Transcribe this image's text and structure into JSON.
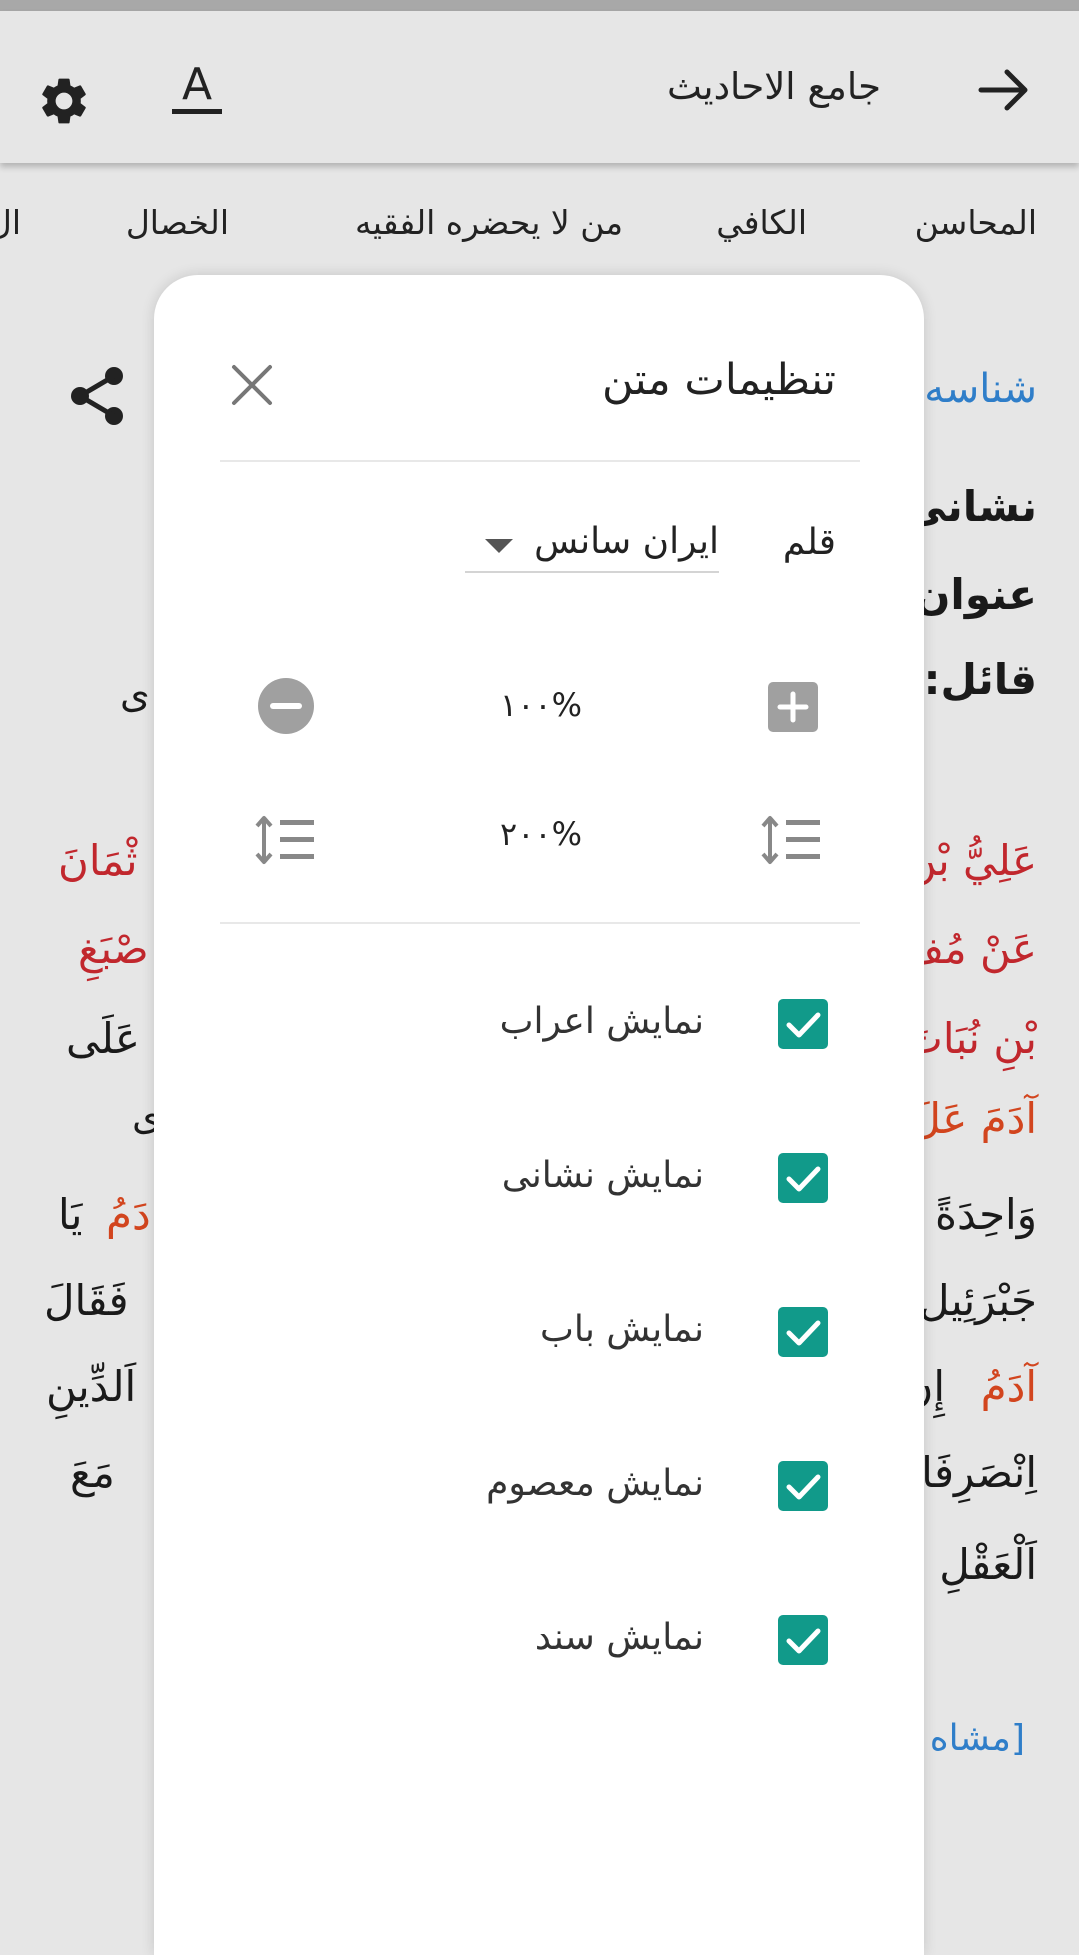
{
  "app_bar": {
    "title": "جامع الاحادیث",
    "font_icon_glyph": "A"
  },
  "book_tabs": [
    "المحاسن",
    "الكافي",
    "من لا يحضره الفقيه",
    "الخصال",
    "ال"
  ],
  "background": {
    "id_label": "شناسه",
    "line_neshani": "نشانی",
    "line_onvan": "عنوان",
    "line_qael": "قائل: ا",
    "line_qael_left": "ی",
    "hadith_lines": [
      {
        "right": "عَلِيُّ بْن",
        "left": "ثْمَانَ"
      },
      {
        "right": "عَنْ مُفَ",
        "left": "صْبَغِ"
      },
      {
        "right": "بْنِ نُبَاتَ",
        "left": "عَلَى"
      },
      {
        "right": "آدَمَ عَلَ",
        "left": "ى"
      },
      {
        "right": "وَاحِدَةً",
        "left_orange": "دَمُ",
        "left": "يَا"
      },
      {
        "right": "جَبْرَئِيل",
        "left": "فَقَالَ"
      },
      {
        "right_orange": "آدَمُ",
        "right": "إِنِّ",
        "left": "اَلدِّينِ"
      },
      {
        "right": "اِنْصَرِفَا",
        "left": "مَعَ"
      },
      {
        "right": "اَلْعَقْلِ",
        "left": ""
      }
    ],
    "see_more": "[مشاه"
  },
  "panel": {
    "title": "تنظیمات متن",
    "font_label": "قلم",
    "font_value": "ایران سانس",
    "font_size_value": "۱۰۰%",
    "line_height_value": "۲۰۰%",
    "checkboxes": [
      {
        "label": "نمایش اعراب",
        "checked": true
      },
      {
        "label": "نمایش نشانی",
        "checked": true
      },
      {
        "label": "نمایش باب",
        "checked": true
      },
      {
        "label": "نمایش معصوم",
        "checked": true
      },
      {
        "label": "نمایش سند",
        "checked": true
      }
    ]
  },
  "colors": {
    "accent_teal": "#119a8a",
    "link_blue": "#2f7ec9",
    "hadith_red": "#c1272d",
    "hadith_orange": "#d2451e"
  },
  "icons": {
    "back": "arrow-right-icon",
    "font": "text-format-icon",
    "settings": "gear-icon",
    "share": "share-icon",
    "close": "close-icon",
    "increase": "plus-icon",
    "decrease": "minus-icon",
    "line_height": "line-spacing-icon",
    "check": "check-icon",
    "dropdown": "caret-down-icon"
  }
}
